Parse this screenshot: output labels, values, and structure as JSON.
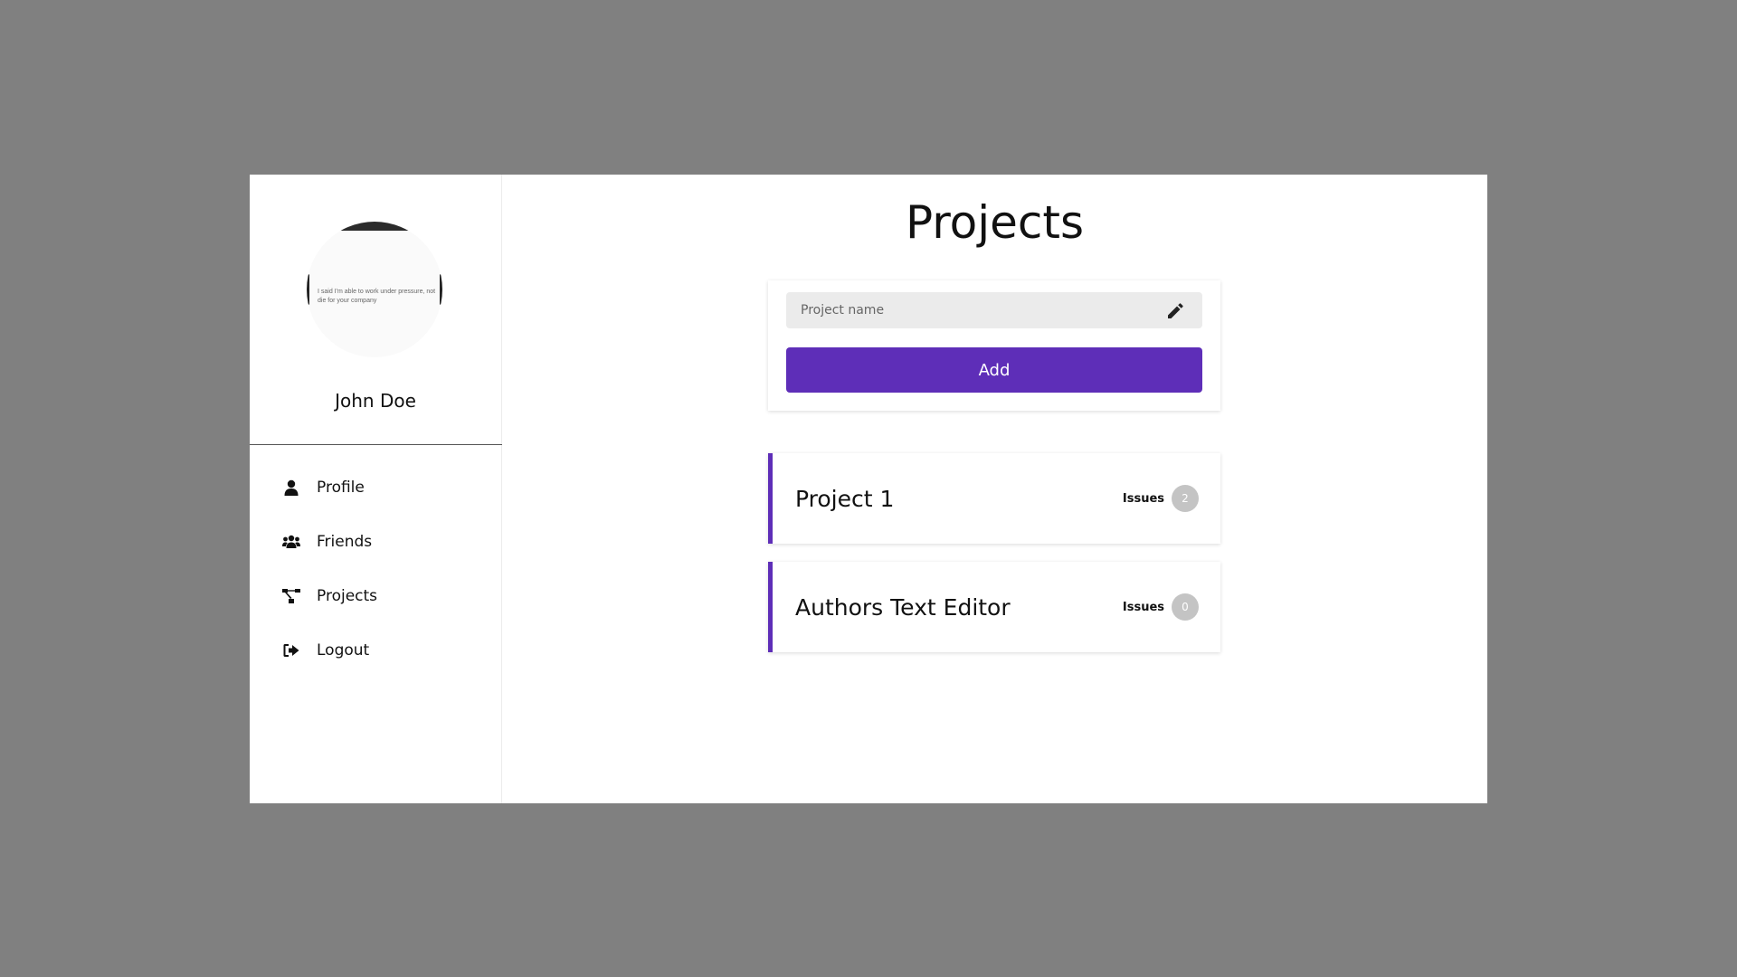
{
  "sidebar": {
    "avatar_caption": "I said I'm able to work under pressure, not die for your company",
    "user_name": "John Doe",
    "nav": [
      {
        "label": "Profile",
        "icon": "user-icon"
      },
      {
        "label": "Friends",
        "icon": "users-icon"
      },
      {
        "label": "Projects",
        "icon": "project-diagram-icon"
      },
      {
        "label": "Logout",
        "icon": "logout-icon"
      }
    ]
  },
  "main": {
    "title": "Projects",
    "add_form": {
      "placeholder": "Project name",
      "value": "",
      "add_label": "Add"
    },
    "projects": [
      {
        "name": "Project 1",
        "issues_label": "Issues",
        "issues_count": "2"
      },
      {
        "name": "Authors Text Editor",
        "issues_label": "Issues",
        "issues_count": "0"
      }
    ]
  },
  "colors": {
    "accent": "#5e2eb8",
    "backdrop": "#808080",
    "badge": "#c4c4c4"
  }
}
